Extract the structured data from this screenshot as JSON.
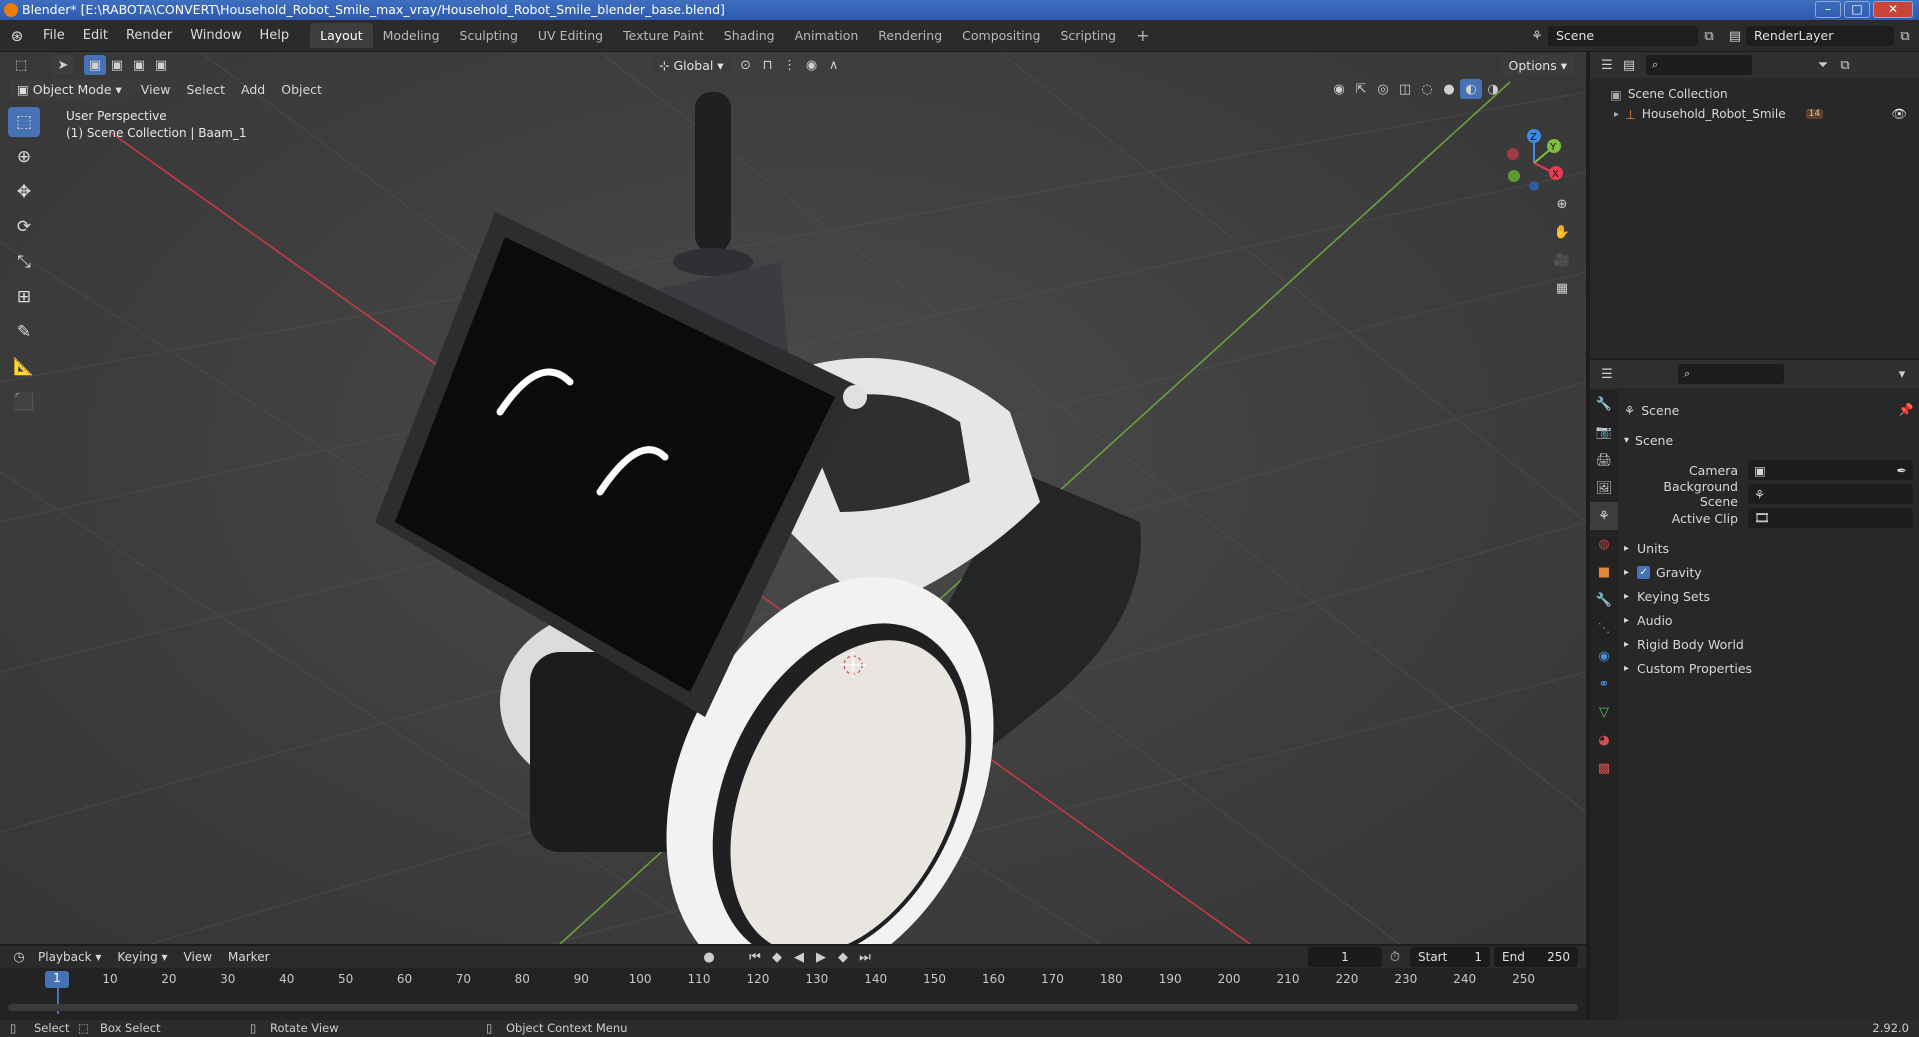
{
  "window": {
    "title": "Blender* [E:\\RABOTA\\CONVERT\\Household_Robot_Smile_max_vray/Household_Robot_Smile_blender_base.blend]"
  },
  "menu": [
    "File",
    "Edit",
    "Render",
    "Window",
    "Help"
  ],
  "workspaces": [
    "Layout",
    "Modeling",
    "Sculpting",
    "UV Editing",
    "Texture Paint",
    "Shading",
    "Animation",
    "Rendering",
    "Compositing",
    "Scripting"
  ],
  "scene_name": "Scene",
  "view_layer": "RenderLayer",
  "header": {
    "transform_orientation": "Global",
    "options": "Options"
  },
  "viewport_header": {
    "mode": "Object Mode",
    "menus": [
      "View",
      "Select",
      "Add",
      "Object"
    ]
  },
  "viewport": {
    "perspective": "User Perspective",
    "collection_info": "(1) Scene Collection | Baam_1"
  },
  "outliner": {
    "root": "Scene Collection",
    "item": "Household_Robot_Smile",
    "item_badge": "14"
  },
  "properties": {
    "context": "Scene",
    "panel": "Scene",
    "fields": [
      {
        "label": "Camera"
      },
      {
        "label": "Background Scene"
      },
      {
        "label": "Active Clip"
      }
    ],
    "sections": [
      "Units",
      "Gravity",
      "Keying Sets",
      "Audio",
      "Rigid Body World",
      "Custom Properties"
    ],
    "gravity_checked": true
  },
  "timeline": {
    "menus": [
      "Playback",
      "Keying",
      "View",
      "Marker"
    ],
    "current_frame": "1",
    "start_label": "Start",
    "start": "1",
    "end_label": "End",
    "end": "250",
    "ticks": [
      "10",
      "20",
      "30",
      "40",
      "50",
      "60",
      "70",
      "80",
      "90",
      "100",
      "110",
      "120",
      "130",
      "140",
      "150",
      "160",
      "170",
      "180",
      "190",
      "200",
      "210",
      "220",
      "230",
      "240",
      "250"
    ],
    "playhead": "1"
  },
  "status": {
    "select": "Select",
    "box_select": "Box Select",
    "rotate": "Rotate View",
    "context_menu": "Object Context Menu",
    "version": "2.92.0"
  },
  "colors": {
    "accent": "#4772b3",
    "axis_x": "#e83a52",
    "axis_y": "#7fbf3f",
    "axis_z": "#3d8be6"
  }
}
